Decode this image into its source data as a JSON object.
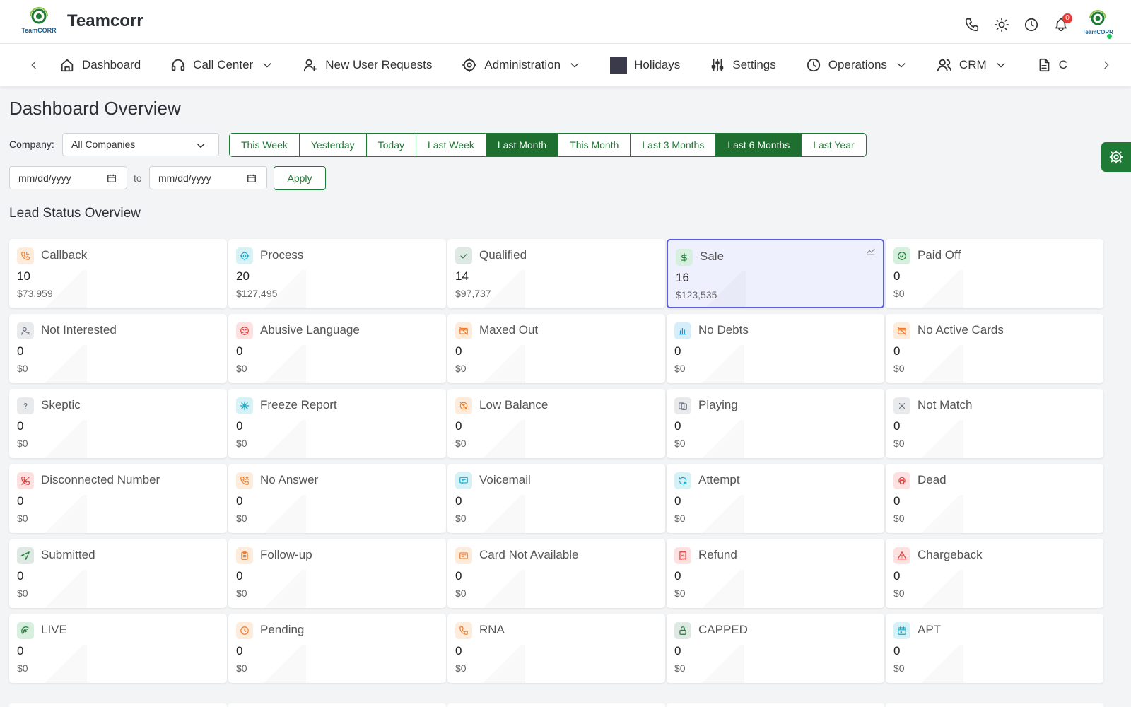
{
  "header": {
    "brand": "Teamcorr",
    "logo_text": "TeamCORR",
    "notification_count": "0",
    "icons": [
      "phone-icon",
      "sun-icon",
      "clock-icon",
      "bell-icon"
    ]
  },
  "nav": {
    "items": [
      {
        "label": "Dashboard",
        "icon": "home-icon",
        "dropdown": false
      },
      {
        "label": "Call Center",
        "icon": "headset-icon",
        "dropdown": true
      },
      {
        "label": "New User Requests",
        "icon": "user-plus-icon",
        "dropdown": false
      },
      {
        "label": "Administration",
        "icon": "gear-icon",
        "dropdown": true
      },
      {
        "label": "Holidays",
        "icon": "calendar-square-icon",
        "dropdown": false
      },
      {
        "label": "Settings",
        "icon": "sliders-icon",
        "dropdown": false
      },
      {
        "label": "Operations",
        "icon": "clock-icon",
        "dropdown": true
      },
      {
        "label": "CRM",
        "icon": "users-icon",
        "dropdown": true
      },
      {
        "label": "C",
        "icon": "document-icon",
        "dropdown": false
      }
    ]
  },
  "main": {
    "title": "Dashboard Overview",
    "company_label": "Company:",
    "company_value": "All Companies",
    "ranges": [
      {
        "label": "This Week",
        "active": false
      },
      {
        "label": "Yesterday",
        "active": false
      },
      {
        "label": "Today",
        "active": false
      },
      {
        "label": "Last Week",
        "active": false
      },
      {
        "label": "Last Month",
        "active": true
      },
      {
        "label": "This Month",
        "active": false
      },
      {
        "label": "Last 3 Months",
        "active": false
      },
      {
        "label": "Last 6 Months",
        "active": true
      },
      {
        "label": "Last Year",
        "active": false
      }
    ],
    "date_from_placeholder": "mm/dd/yyyy",
    "date_to_placeholder": "mm/dd/yyyy",
    "to_label": "to",
    "apply_label": "Apply",
    "section_title": "Lead Status Overview"
  },
  "colors": {
    "brand_green": "#1e7a34",
    "selected_border": "#5b5fe0"
  },
  "cards": [
    {
      "label": "Callback",
      "count": "10",
      "amount": "$73,959",
      "icon": "phone-callback-icon",
      "bg": "#fdecdc",
      "fg": "#f07c2b"
    },
    {
      "label": "Process",
      "count": "20",
      "amount": "$127,495",
      "icon": "gear-icon",
      "bg": "#d6f2f7",
      "fg": "#1aa6c2"
    },
    {
      "label": "Qualified",
      "count": "14",
      "amount": "$97,737",
      "icon": "check-icon",
      "bg": "#dfe9e3",
      "fg": "#3c7a55"
    },
    {
      "label": "Sale",
      "count": "16",
      "amount": "$123,535",
      "icon": "dollar-icon",
      "bg": "#d6efde",
      "fg": "#1e7a34",
      "selected": true
    },
    {
      "label": "Paid Off",
      "count": "0",
      "amount": "$0",
      "icon": "check-circle-icon",
      "bg": "#d6efde",
      "fg": "#1e7a34"
    },
    {
      "label": "Not Interested",
      "count": "0",
      "amount": "$0",
      "icon": "user-x-icon",
      "bg": "#e9eaec",
      "fg": "#6b7280"
    },
    {
      "label": "Abusive Language",
      "count": "0",
      "amount": "$0",
      "icon": "angry-face-icon",
      "bg": "#fde0e0",
      "fg": "#e53935"
    },
    {
      "label": "Maxed Out",
      "count": "0",
      "amount": "$0",
      "icon": "card-off-icon",
      "bg": "#fdecdc",
      "fg": "#f07c2b"
    },
    {
      "label": "No Debts",
      "count": "0",
      "amount": "$0",
      "icon": "bar-chart-icon",
      "bg": "#d6eef9",
      "fg": "#1a8fd1"
    },
    {
      "label": "No Active Cards",
      "count": "0",
      "amount": "$0",
      "icon": "card-off-icon",
      "bg": "#fdecdc",
      "fg": "#f07c2b"
    },
    {
      "label": "Skeptic",
      "count": "0",
      "amount": "$0",
      "icon": "question-icon",
      "bg": "#e9eaec",
      "fg": "#6b7280"
    },
    {
      "label": "Freeze Report",
      "count": "0",
      "amount": "$0",
      "icon": "snowflake-icon",
      "bg": "#d6f2f7",
      "fg": "#1aa6c2"
    },
    {
      "label": "Low Balance",
      "count": "0",
      "amount": "$0",
      "icon": "coin-off-icon",
      "bg": "#fdecdc",
      "fg": "#f07c2b"
    },
    {
      "label": "Playing",
      "count": "0",
      "amount": "$0",
      "icon": "cards-icon",
      "bg": "#e9eaec",
      "fg": "#6b7280"
    },
    {
      "label": "Not Match",
      "count": "0",
      "amount": "$0",
      "icon": "x-icon",
      "bg": "#e9eaec",
      "fg": "#6b7280"
    },
    {
      "label": "Disconnected Number",
      "count": "0",
      "amount": "$0",
      "icon": "phone-off-icon",
      "bg": "#fde0e0",
      "fg": "#e53935"
    },
    {
      "label": "No Answer",
      "count": "0",
      "amount": "$0",
      "icon": "phone-missed-icon",
      "bg": "#fdecdc",
      "fg": "#f07c2b"
    },
    {
      "label": "Voicemail",
      "count": "0",
      "amount": "$0",
      "icon": "message-icon",
      "bg": "#d6f2f7",
      "fg": "#1aa6c2"
    },
    {
      "label": "Attempt",
      "count": "0",
      "amount": "$0",
      "icon": "refresh-icon",
      "bg": "#d6f2f7",
      "fg": "#1aa6c2"
    },
    {
      "label": "Dead",
      "count": "0",
      "amount": "$0",
      "icon": "skull-icon",
      "bg": "#fde0e0",
      "fg": "#e53935"
    },
    {
      "label": "Submitted",
      "count": "0",
      "amount": "$0",
      "icon": "send-icon",
      "bg": "#dfe9e3",
      "fg": "#1e7a34"
    },
    {
      "label": "Follow-up",
      "count": "0",
      "amount": "$0",
      "icon": "clipboard-icon",
      "bg": "#fdecdc",
      "fg": "#f07c2b"
    },
    {
      "label": "Card Not Available",
      "count": "0",
      "amount": "$0",
      "icon": "id-card-icon",
      "bg": "#fdecdc",
      "fg": "#f07c2b"
    },
    {
      "label": "Refund",
      "count": "0",
      "amount": "$0",
      "icon": "receipt-icon",
      "bg": "#fde0e0",
      "fg": "#e53935"
    },
    {
      "label": "Chargeback",
      "count": "0",
      "amount": "$0",
      "icon": "alert-triangle-icon",
      "bg": "#fde0e0",
      "fg": "#e53935"
    },
    {
      "label": "LIVE",
      "count": "0",
      "amount": "$0",
      "icon": "broadcast-icon",
      "bg": "#d6efde",
      "fg": "#1e7a34"
    },
    {
      "label": "Pending",
      "count": "0",
      "amount": "$0",
      "icon": "clock-icon",
      "bg": "#fdecdc",
      "fg": "#f07c2b"
    },
    {
      "label": "RNA",
      "count": "0",
      "amount": "$0",
      "icon": "phone-icon",
      "bg": "#fdecdc",
      "fg": "#f07c2b"
    },
    {
      "label": "CAPPED",
      "count": "0",
      "amount": "$0",
      "icon": "lock-icon",
      "bg": "#dfe9e3",
      "fg": "#1e7a34"
    },
    {
      "label": "APT",
      "count": "0",
      "amount": "$0",
      "icon": "calendar-icon",
      "bg": "#d6f2f7",
      "fg": "#1aa6c2"
    }
  ]
}
